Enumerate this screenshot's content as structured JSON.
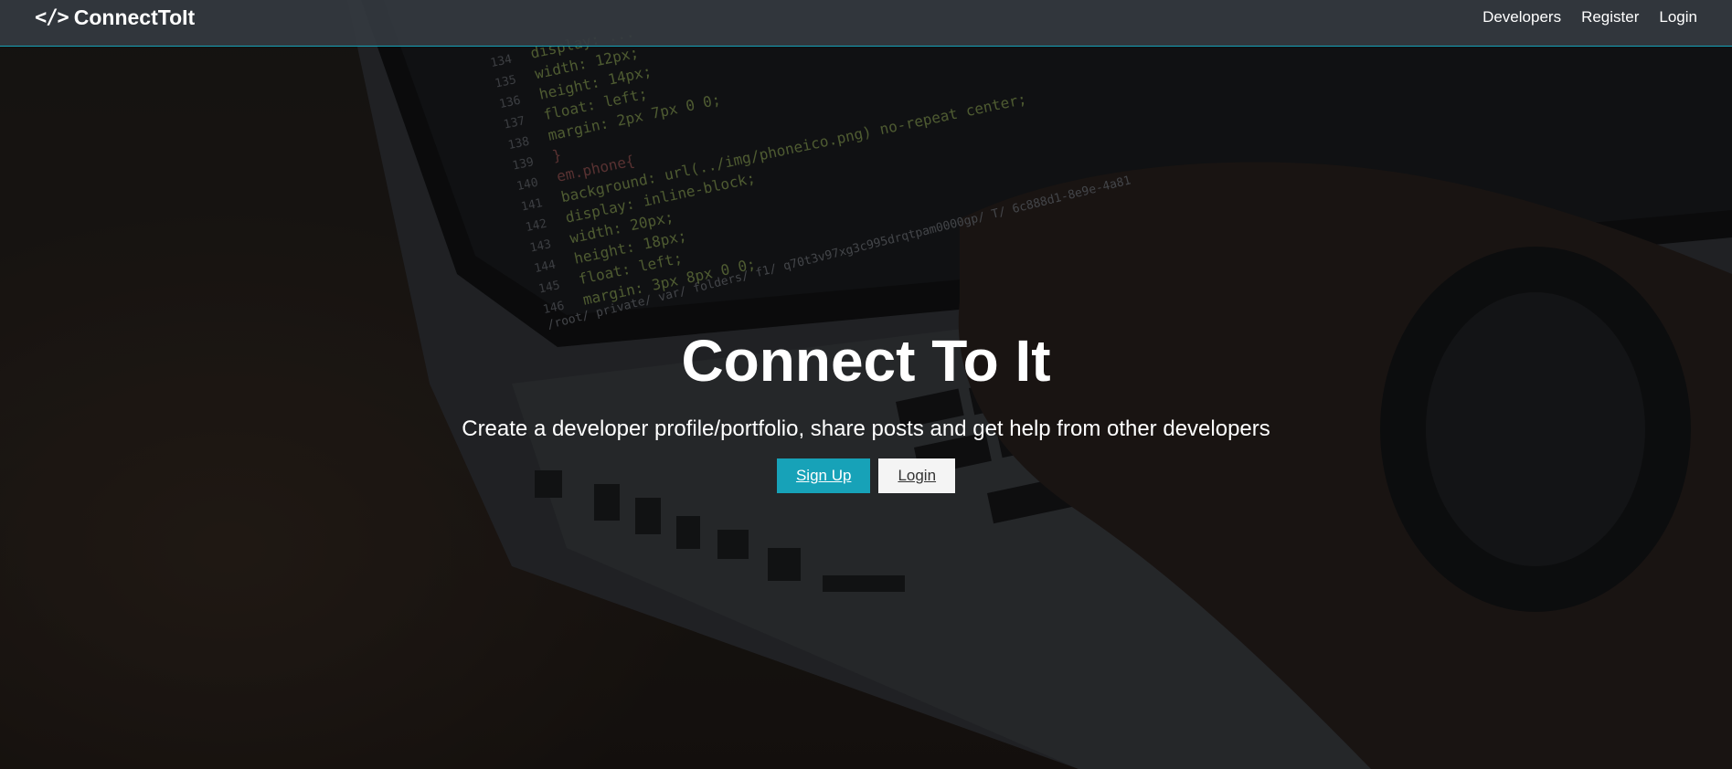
{
  "navbar": {
    "brand_icon": "</>",
    "brand_name": "ConnectToIt",
    "links": [
      {
        "label": "Developers"
      },
      {
        "label": "Register"
      },
      {
        "label": "Login"
      }
    ],
    "accent_color": "#17a2b8"
  },
  "hero": {
    "title": "Connect To It",
    "subtitle": "Create a developer profile/portfolio, share posts and get help from other developers",
    "signup_label": "Sign Up",
    "login_label": "Login"
  },
  "background": {
    "code_lines": [
      {
        "num": "134",
        "text": "display: ..."
      },
      {
        "num": "135",
        "text": "width: 12px;"
      },
      {
        "num": "136",
        "text": "height: 14px;"
      },
      {
        "num": "137",
        "text": "float: left;"
      },
      {
        "num": "138",
        "text": "margin: 2px 7px 0 0;"
      },
      {
        "num": "139",
        "text": "}"
      },
      {
        "num": "140",
        "text": "em.phone{"
      },
      {
        "num": "141",
        "text": "background: url(../img/phoneico.png) no-repeat center;"
      },
      {
        "num": "142",
        "text": "display: inline-block;"
      },
      {
        "num": "143",
        "text": "width: 20px;"
      },
      {
        "num": "144",
        "text": "height: 18px;"
      },
      {
        "num": "145",
        "text": "float: left;"
      },
      {
        "num": "146",
        "text": "margin: 3px 8px 0 0;"
      }
    ],
    "status_path": "/root/ private/ var/ folders/ f1/ q70t3v97xg3c995drqtpam0000gp/ T/ 6c888d1-8e9e-4a81"
  }
}
